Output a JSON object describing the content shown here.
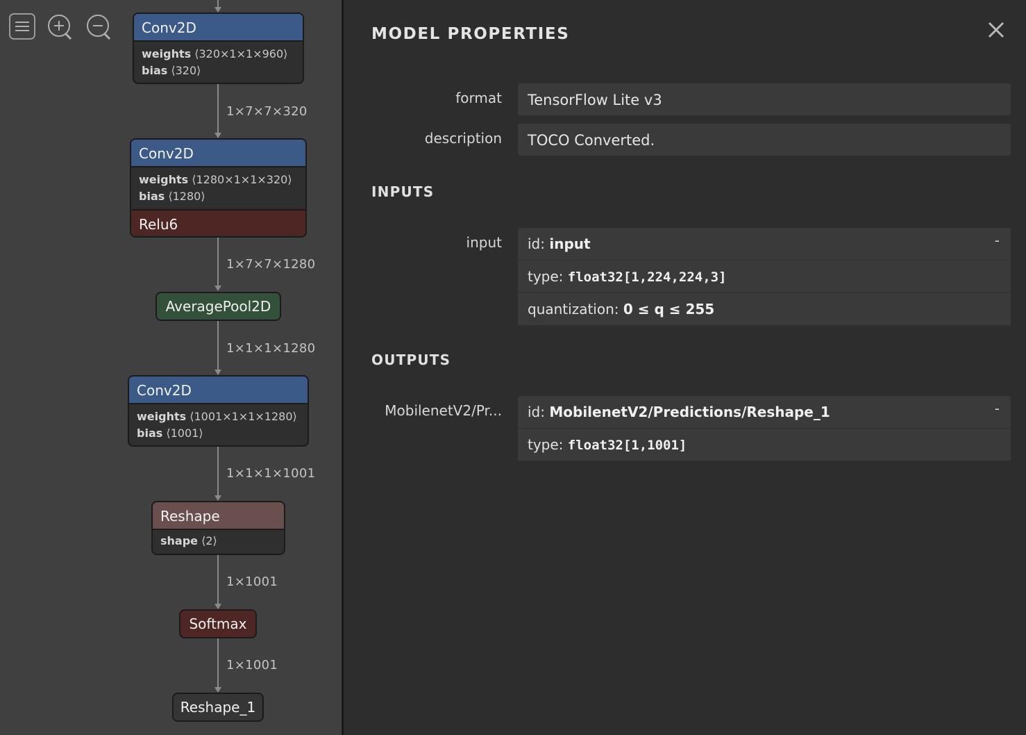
{
  "toolbar": {
    "menu_icon": "menu-icon",
    "zoom_in_icon": "zoom-in-icon",
    "zoom_out_icon": "zoom-out-icon"
  },
  "graph": {
    "conv1": {
      "title": "Conv2D",
      "w_key": "weights",
      "w_val": "⟨320×1×1×960⟩",
      "b_key": "bias",
      "b_val": "⟨320⟩"
    },
    "edge1": "1×7×7×320",
    "conv2": {
      "title": "Conv2D",
      "w_key": "weights",
      "w_val": "⟨1280×1×1×320⟩",
      "b_key": "bias",
      "b_val": "⟨1280⟩",
      "activation": "Relu6"
    },
    "edge2": "1×7×7×1280",
    "pool": "AveragePool2D",
    "edge3": "1×1×1×1280",
    "conv3": {
      "title": "Conv2D",
      "w_key": "weights",
      "w_val": "⟨1001×1×1×1280⟩",
      "b_key": "bias",
      "b_val": "⟨1001⟩"
    },
    "edge4": "1×1×1×1001",
    "reshape": {
      "title": "Reshape",
      "s_key": "shape",
      "s_val": "⟨2⟩"
    },
    "edge5": "1×1001",
    "softmax": "Softmax",
    "edge6": "1×1001",
    "output": "Reshape_1"
  },
  "sidebar": {
    "title": "MODEL PROPERTIES",
    "format_label": "format",
    "format_value": "TensorFlow Lite v3",
    "description_label": "description",
    "description_value": "TOCO Converted.",
    "inputs_title": "INPUTS",
    "input": {
      "name": "input",
      "id_key": "id: ",
      "id_val": "input",
      "type_key": "type: ",
      "type_val": "float32[1,224,224,3]",
      "quant_key": "quantization: ",
      "quant_val": "0 ≤ q ≤ 255",
      "toggle": "-"
    },
    "outputs_title": "OUTPUTS",
    "output": {
      "name": "MobilenetV2/Pr...",
      "id_key": "id: ",
      "id_val": "MobilenetV2/Predictions/Reshape_1",
      "type_key": "type: ",
      "type_val": "float32[1,1001]",
      "toggle": "-"
    }
  }
}
